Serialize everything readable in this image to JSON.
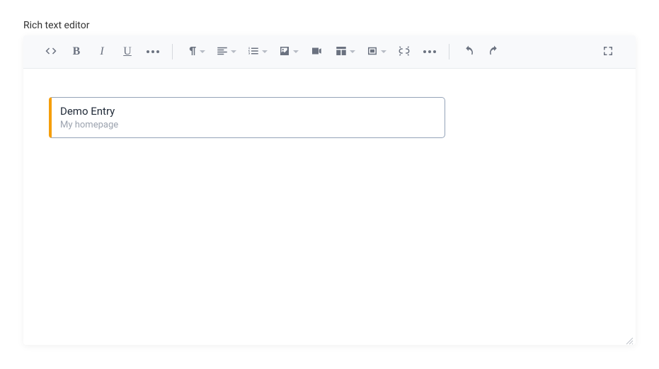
{
  "label": "Rich text editor",
  "toolbar": {
    "bold": "B",
    "italic": "I",
    "underline": "U"
  },
  "entry": {
    "title": "Demo Entry",
    "subtitle": "My homepage"
  }
}
